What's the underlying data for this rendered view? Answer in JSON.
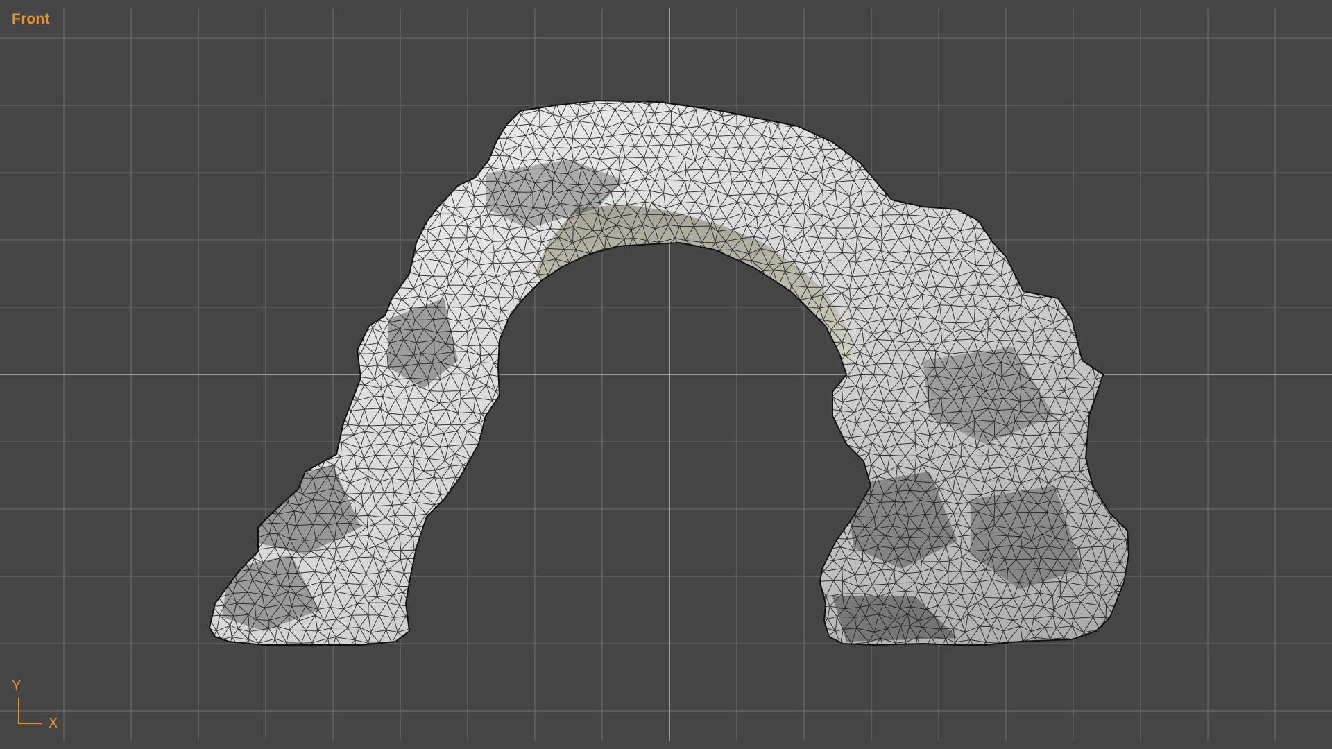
{
  "viewport": {
    "label": "Front",
    "background_color": "#454545",
    "grid_color": "#6e6e6e",
    "axis_line_color": "#b4b4b4",
    "label_color": "#e8962c",
    "show_grid": true
  },
  "axis_gizmo": {
    "y_label": "Y",
    "x_label": "X"
  },
  "model": {
    "type": "rock-arch-wireframe-mesh",
    "shading": "smooth-gray-with-wireframe",
    "wire_color": "#1a1a1a",
    "fill_light": "#e6e6e6",
    "fill_shadow": "#8c8c8c",
    "underside_tint": "#c9c9b4"
  }
}
